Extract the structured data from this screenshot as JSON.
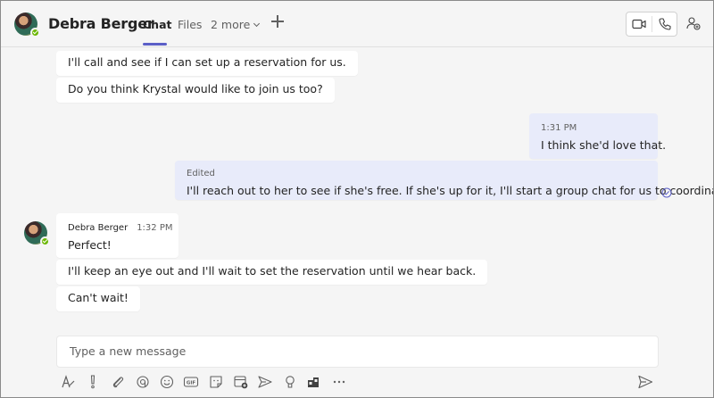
{
  "header": {
    "name": "Debra Berger",
    "tabs": [
      {
        "label": "Chat",
        "active": true
      },
      {
        "label": "Files",
        "active": false
      }
    ],
    "more_label": "2 more",
    "accent": "#5b5fc7",
    "presence_color": "#6bb700"
  },
  "messages": [
    {
      "text": "I'll call and see if I can set up a reservation for us."
    },
    {
      "text": "Do you think Krystal would like to join us too?"
    },
    {
      "time": "1:31 PM",
      "text": "I think she'd love that."
    },
    {
      "status": "Edited",
      "text": "I'll reach out to her to see if she's free. If she's up for it, I'll start a group chat for us to coordinate."
    },
    {
      "author": "Debra Berger",
      "time": "1:32 PM",
      "text": "Perfect!"
    },
    {
      "text": "I'll keep an eye out and I'll wait to set the reservation until we hear back."
    },
    {
      "text": "Can't wait!"
    }
  ],
  "compose": {
    "placeholder": "Type a new message",
    "tools": [
      "format-icon",
      "important-icon",
      "attach-icon",
      "loop-icon",
      "emoji-icon",
      "gif-icon",
      "sticker-icon",
      "schedule-meeting-icon",
      "stream-icon",
      "praise-icon",
      "apps-icon",
      "more-options-icon"
    ]
  },
  "icons": {
    "video_call": "video-call-icon",
    "audio_call": "audio-call-icon",
    "add_people": "add-people-icon",
    "send": "send-icon",
    "seen": "seen-icon"
  }
}
